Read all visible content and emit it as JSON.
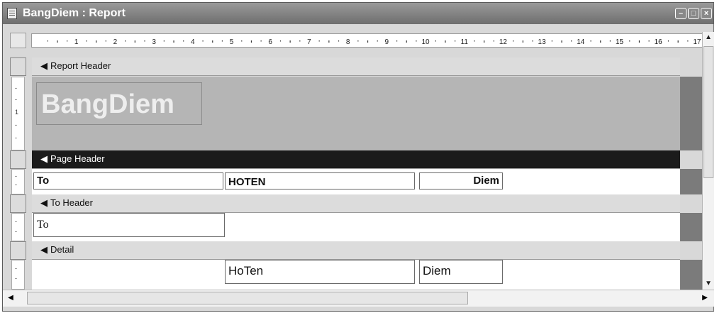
{
  "window": {
    "title": "BangDiem : Report",
    "min_icon": "minimize-icon",
    "max_icon": "maximize-icon",
    "close_icon": "close-icon"
  },
  "ruler": {
    "ticks": [
      "1",
      "2",
      "3",
      "4",
      "5",
      "6",
      "7",
      "8",
      "9",
      "10",
      "11",
      "12",
      "13",
      "14",
      "15",
      "16",
      "17"
    ]
  },
  "sections": {
    "report_header": {
      "label": "Report Header",
      "title": "BangDiem"
    },
    "page_header": {
      "label": "Page Header",
      "cols": [
        "To",
        "HOTEN",
        "Diem"
      ]
    },
    "to_header": {
      "label": "To Header",
      "field": "To"
    },
    "detail": {
      "label": "Detail",
      "fields": [
        "HoTen",
        "Diem"
      ]
    }
  },
  "vertical_ruler": {
    "mark": "1"
  },
  "colors": {
    "title_bar": "#7a7a7a",
    "band_dark": "#1b1b1b",
    "band_light": "#dcdcdc",
    "header_fill": "#b5b5b5"
  }
}
